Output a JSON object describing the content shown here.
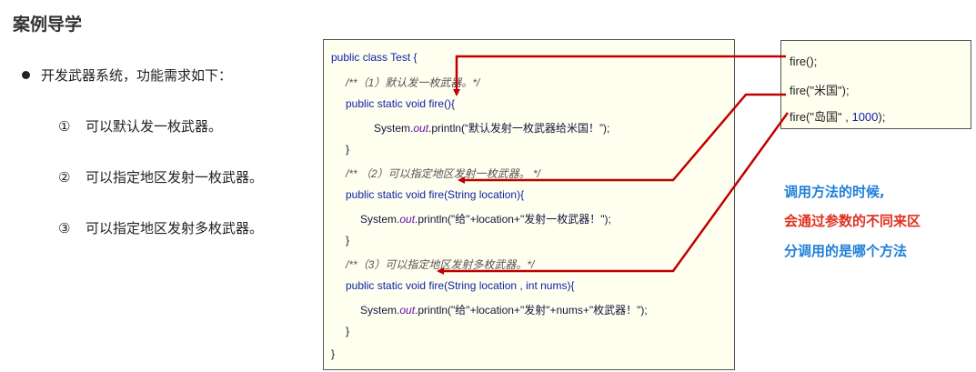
{
  "title": "案例导学",
  "intro": "开发武器系统，功能需求如下：",
  "requirements": [
    {
      "num": "①",
      "text": "可以默认发一枚武器。"
    },
    {
      "num": "②",
      "text": "可以指定地区发射一枚武器。"
    },
    {
      "num": "③",
      "text": "可以指定地区发射多枚武器。"
    }
  ],
  "code": {
    "class_decl": "public class Test {",
    "comment1": "/**（1）默认发一枚武器。*/",
    "method1_kw": "public static void ",
    "method1_name": "fire",
    "method1_rest": "(){",
    "stmt1_pre": "System.",
    "stmt1_out": "out",
    "stmt1_post": ".println(“默认发射一枚武器给米国！”);",
    "close1": "}",
    "comment2": "/** （2）可以指定地区发射一枚武器。 */",
    "method2_kw": "public static void ",
    "method2_name": "fire",
    "method2_rest": "(String location){",
    "stmt2_pre": "System.",
    "stmt2_out": "out",
    "stmt2_post": ".println(\"给\"+location+\"发射一枚武器！\");",
    "close2": "}",
    "comment3": "/**（3）可以指定地区发射多枚武器。*/",
    "method3_kw": "public static void ",
    "method3_name": "fire",
    "method3_rest": "(String location , ",
    "method3_int": "int",
    "method3_end": " nums){",
    "stmt3_pre": "System.",
    "stmt3_out": "out",
    "stmt3_post": ".println(\"给\"+location+\"发射\"+nums+\"枚武器！\");",
    "close3": "}",
    "close_class": "}"
  },
  "calls": {
    "call1": "fire();",
    "call2": "fire(\"米国\");",
    "call3_pre": "fire(\"岛国\" , ",
    "call3_num": "1000",
    "call3_post": ");"
  },
  "note": {
    "line1": "调用方法的时候,",
    "line2": "会通过参数的不同来区",
    "line3": "分调用的是哪个方法"
  },
  "colors": {
    "arrow": "#c00000",
    "keyword": "#0b1fa8",
    "note_blue": "#1e7fd8",
    "note_red": "#e0301e"
  }
}
